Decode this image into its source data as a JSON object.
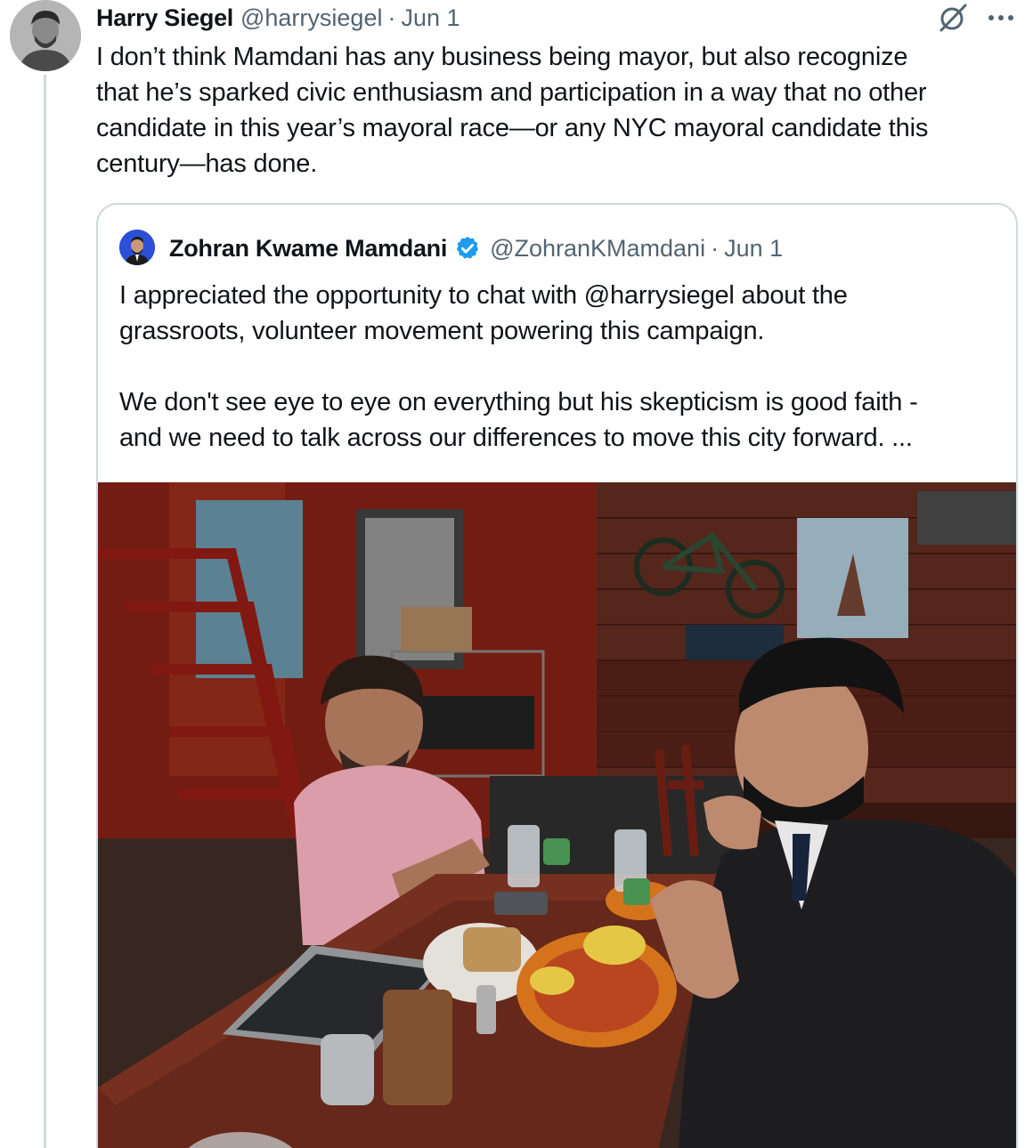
{
  "tweet": {
    "author_name": "Harry Siegel",
    "handle": "@harrysiegel",
    "separator": "·",
    "date": "Jun 1",
    "lines": [
      "I don’t think Mamdani has any business being mayor, but also recognize",
      "that he’s sparked civic enthusiasm and participation in a way that no other",
      "candidate in this year’s mayoral race—or any NYC mayoral candidate this",
      "century—has done."
    ]
  },
  "quoted": {
    "author_name": "Zohran Kwame Mamdani",
    "handle": "@ZohranKMamdani",
    "separator": "·",
    "date": "Jun 1",
    "paragraph1": [
      "I appreciated the opportunity to chat with @harrysiegel about the",
      "grassroots, volunteer movement powering this campaign."
    ],
    "paragraph2": [
      "We don't see eye to eye on everything but his skepticism is good faith -",
      "and we need to talk across our differences to move this city forward.  ..."
    ]
  },
  "icons": {
    "grok": "grok-icon",
    "more": "more-icon",
    "verified": "verified-badge-icon"
  },
  "colors": {
    "text": "#0f1419",
    "secondary": "#536471",
    "border": "#cfd9de",
    "verified": "#1d9bf0"
  }
}
